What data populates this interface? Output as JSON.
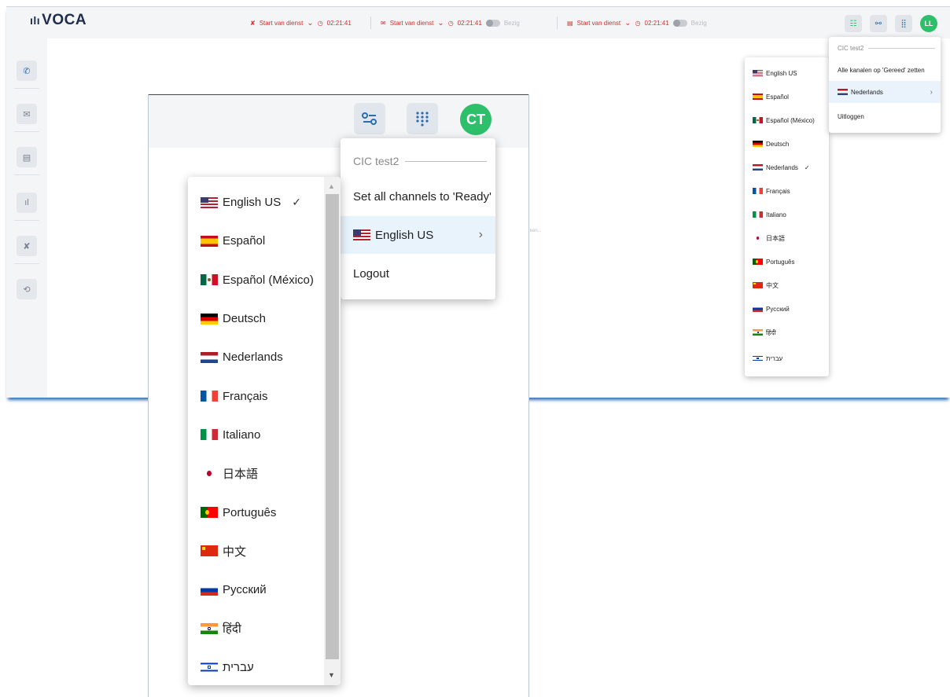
{
  "background_app": {
    "logo": "VOCA",
    "channels": [
      {
        "label": "Start van dienst",
        "timer": "02:21:41",
        "status": ""
      },
      {
        "label": "Start van dienst",
        "timer": "02:21:41",
        "status": "Bezig"
      },
      {
        "label": "Start van dienst",
        "timer": "02:21:41",
        "status": "Bezig"
      }
    ],
    "avatar": "LL",
    "faint_text": "ken...",
    "account_menu": {
      "header": "CIC test2",
      "set_ready": "Alle kanalen op 'Gereed' zetten",
      "language": "Nederlands",
      "logout": "Uitloggen"
    },
    "languages": [
      {
        "label": "English US",
        "flag": "us"
      },
      {
        "label": "Español",
        "flag": "es"
      },
      {
        "label": "Español (México)",
        "flag": "mx"
      },
      {
        "label": "Deutsch",
        "flag": "de"
      },
      {
        "label": "Nederlands",
        "flag": "nl"
      },
      {
        "label": "Français",
        "flag": "fr"
      },
      {
        "label": "Italiano",
        "flag": "it"
      },
      {
        "label": "日本語",
        "flag": "jp"
      },
      {
        "label": "Português",
        "flag": "pt"
      },
      {
        "label": "中文",
        "flag": "cn"
      },
      {
        "label": "Русский",
        "flag": "ru"
      },
      {
        "label": "हिंदी",
        "flag": "in"
      },
      {
        "label": "עברית",
        "flag": "il"
      }
    ],
    "selected_language": "Nederlands"
  },
  "foreground_app": {
    "avatar": "CT",
    "account_menu": {
      "header": "CIC test2",
      "set_ready": "Set all channels to 'Ready'",
      "language": "English US",
      "logout": "Logout"
    },
    "languages": [
      {
        "label": "English US",
        "flag": "us"
      },
      {
        "label": "Español",
        "flag": "es"
      },
      {
        "label": "Español (México)",
        "flag": "mx"
      },
      {
        "label": "Deutsch",
        "flag": "de"
      },
      {
        "label": "Nederlands",
        "flag": "nl"
      },
      {
        "label": "Français",
        "flag": "fr"
      },
      {
        "label": "Italiano",
        "flag": "it"
      },
      {
        "label": "日本語",
        "flag": "jp"
      },
      {
        "label": "Português",
        "flag": "pt"
      },
      {
        "label": "中文",
        "flag": "cn"
      },
      {
        "label": "Русский",
        "flag": "ru"
      },
      {
        "label": "हिंदी",
        "flag": "in"
      },
      {
        "label": "עברית",
        "flag": "il"
      }
    ],
    "selected_language": "English US",
    "check_mark": "✓"
  },
  "colors": {
    "accent_red": "#d0312d",
    "avatar_green": "#2ebf6b",
    "highlight": "#e9f3fb",
    "brand_blue": "#2b6cb0"
  }
}
